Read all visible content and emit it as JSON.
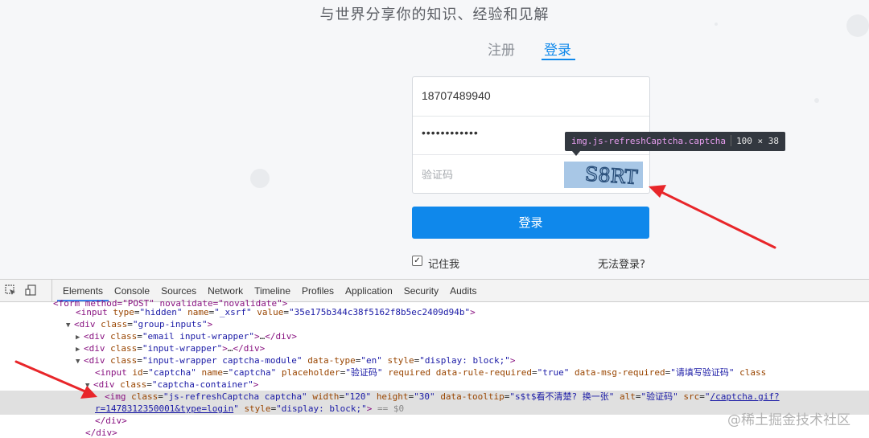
{
  "site": {
    "slogan": "与世界分享你的知识、经验和见解",
    "tabs": {
      "register": "注册",
      "login": "登录"
    },
    "phone_value": "18707489940",
    "password_mask": "••••••••••••",
    "captcha_placeholder": "验证码",
    "captcha_image_text": "S8RT",
    "login_button": "登录",
    "remember_label": "记住我",
    "cant_login": "无法登录?",
    "primary_color": "#0f88eb"
  },
  "tooltip": {
    "selector": "img.js-refreshCaptcha.captcha",
    "dims": "100 × 38"
  },
  "devtools": {
    "tabs": [
      "Elements",
      "Console",
      "Sources",
      "Network",
      "Timeline",
      "Profiles",
      "Application",
      "Security",
      "Audits"
    ],
    "active_tab": "Elements",
    "lines": {
      "l0": "<form method=\"POST\" novalidate=\"novalidate\">",
      "l1_tag": "input",
      "l1_type": "\"hidden\"",
      "l1_name": "\"_xsrf\"",
      "l1_value": "\"35e175b344c38f5162f8b5ec2409d94b\"",
      "l2_class": "\"group-inputs\"",
      "l3_class": "\"email input-wrapper\"",
      "l4_class": "\"input-wrapper\"",
      "l5_class": "\"input-wrapper captcha-module\"",
      "l5_type": "\"en\"",
      "l5_style": "\"display: block;\"",
      "l6_id": "\"captcha\"",
      "l6_name": "\"captcha\"",
      "l6_ph": "\"验证码\"",
      "l6_req": "\"true\"",
      "l6_msg": "\"请填写验证码\"",
      "l7_class": "\"captcha-container\"",
      "l8_class": "\"js-refreshCaptcha captcha\"",
      "l8_width": "\"120\"",
      "l8_height": "\"30\"",
      "l8_tip": "\"s$t$看不清楚? 换一张\"",
      "l8_alt": "\"验证码\"",
      "l8_src1": "/captcha.gif?",
      "l8_src2": "r=1478312350001&type=login",
      "l8_style": "\"display: block;\"",
      "l8_eq": "== $0",
      "l9": "</div>",
      "l10": "</div>"
    }
  },
  "watermark": "@稀土掘金技术社区"
}
